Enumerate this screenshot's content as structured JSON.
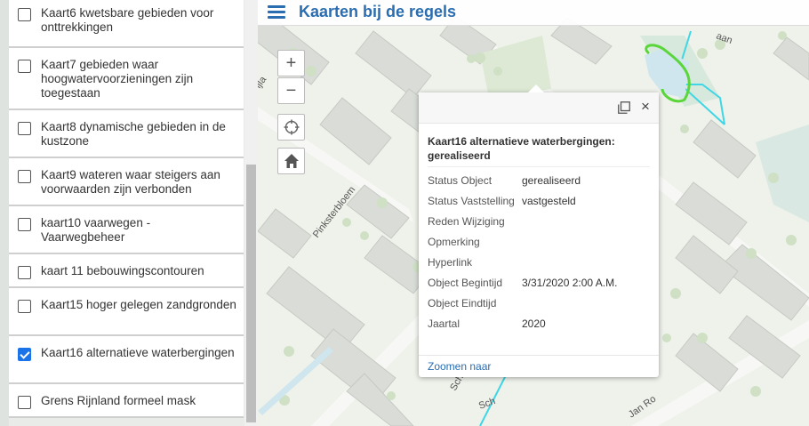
{
  "layers": [
    {
      "label": "Kaart6 kwetsbare gebieden voor onttrekkingen",
      "checked": false
    },
    {
      "label": "Kaart7 gebieden waar hoogwatervoorzieningen zijn toegestaan",
      "checked": false
    },
    {
      "label": "Kaart8 dynamische gebieden in de kustzone",
      "checked": false
    },
    {
      "label": "Kaart9 wateren waar steigers aan voorwaarden zijn verbonden",
      "checked": false
    },
    {
      "label": "kaart10 vaarwegen - Vaarwegbeheer",
      "checked": false
    },
    {
      "label": "kaart 11 bebouwingscontouren",
      "checked": false
    },
    {
      "label": "Kaart15 hoger gelegen zandgronden",
      "checked": false
    },
    {
      "label": "Kaart16 alternatieve waterbergingen",
      "checked": true
    },
    {
      "label": "Grens Rijnland formeel mask",
      "checked": false
    }
  ],
  "map": {
    "title": "Kaarten bij de regels",
    "zoom_in": "+",
    "zoom_out": "−",
    "street_labels": [
      "Pinksterbloem",
      "Jan Ro",
      "Sch",
      "aan",
      "ijla",
      "Sch"
    ]
  },
  "popup": {
    "title": "Kaart16 alternatieve waterbergingen: gerealiseerd",
    "close": "×",
    "fields": [
      {
        "name": "Status Object",
        "value": "gerealiseerd"
      },
      {
        "name": "Status Vaststelling",
        "value": "vastgesteld"
      },
      {
        "name": "Reden Wijziging",
        "value": ""
      },
      {
        "name": "Opmerking",
        "value": ""
      },
      {
        "name": "Hyperlink",
        "value": ""
      },
      {
        "name": "Object Begintijd",
        "value": "3/31/2020 2:00 A.M."
      },
      {
        "name": "Object Eindtijd",
        "value": ""
      },
      {
        "name": "Jaartal",
        "value": "2020"
      }
    ],
    "zoom_to": "Zoomen naar"
  },
  "colors": {
    "accent": "#2a6db0",
    "checkbox_checked": "#1a73e8",
    "map_background": "#eef2ea",
    "building": "#d9dcd7",
    "water_line": "#3fd6e6",
    "highlight_green": "#5bd63a"
  },
  "icons": {
    "menu": "hamburger-icon",
    "locate": "crosshair-icon",
    "home": "home-icon",
    "maximize": "maximize-icon",
    "close": "close-icon"
  }
}
